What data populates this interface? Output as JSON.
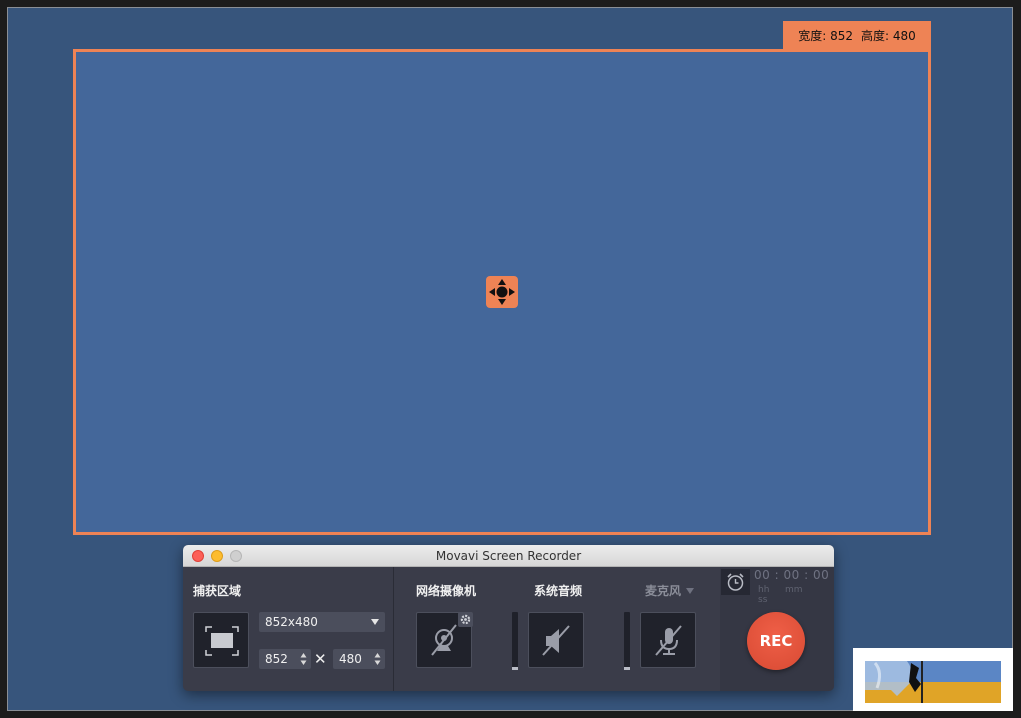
{
  "overlay": {
    "width_label": "宽度:",
    "width_value": "852",
    "height_label": "高度:",
    "height_value": "480",
    "accent_color": "#ee8355"
  },
  "window": {
    "title": "Movavi Screen Recorder"
  },
  "capture_area": {
    "section_title": "捕获区域",
    "preset_selected": "852x480",
    "width_value": "852",
    "height_value": "480",
    "times_symbol": "✕"
  },
  "webcam": {
    "section_title": "网络摄像机",
    "icon": "webcam-off-icon"
  },
  "system_audio": {
    "section_title": "系统音频",
    "icon": "speaker-muted-icon"
  },
  "microphone": {
    "section_title": "麦克风",
    "icon": "mic-off-icon"
  },
  "timer": {
    "hours": "00",
    "minutes": "00",
    "seconds": "00",
    "separator": ":",
    "hours_unit": "hh",
    "minutes_unit": "mm",
    "seconds_unit": "ss"
  },
  "record_button": {
    "label": "REC",
    "color": "#e0533b"
  }
}
